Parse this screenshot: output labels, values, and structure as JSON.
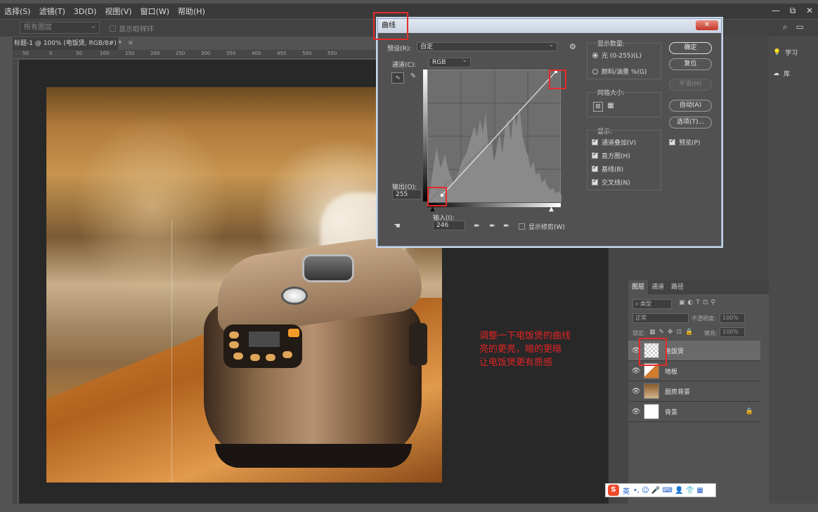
{
  "menu": {
    "items": [
      "选择(S)",
      "滤镜(T)",
      "3D(D)",
      "视图(V)",
      "窗口(W)",
      "帮助(H)"
    ],
    "window_controls": [
      "—",
      "⧉",
      "✕"
    ]
  },
  "options_bar": {
    "sample_select": "所有图层",
    "show_transform": "显示取样环"
  },
  "document": {
    "tab_title": "标题-1 @ 100% (电饭煲, RGB/8#) *",
    "tab_close": "✕",
    "ruler_marks": [
      "50",
      "0",
      "50",
      "100",
      "150",
      "200",
      "250",
      "300",
      "350",
      "400",
      "450",
      "500",
      "550"
    ]
  },
  "annotation": {
    "line1": "调整一下电饭煲的曲线",
    "line2": "亮的更亮，暗的更暗",
    "line3": "让电饭煲更有质感"
  },
  "curves_dialog": {
    "title": "曲线",
    "close": "✕",
    "preset_label": "预设(R):",
    "preset_value": "自定",
    "channel_label": "通道(C):",
    "channel_value": "RGB",
    "output_label": "输出(O):",
    "output_value": "255",
    "input_label": "输入(I):",
    "input_value": "246",
    "show_clipping": "显示修剪(W)",
    "display_amount_label": "显示数量:",
    "light_option": "光 (0-255)(L)",
    "pigment_option": "颜料/油墨 %(G)",
    "grid_size_label": "网格大小:",
    "show_label": "显示:",
    "show_options": [
      "通道叠加(V)",
      "直方图(H)",
      "基线(B)",
      "交叉线(N)"
    ],
    "preview": "预览(P)",
    "buttons": {
      "ok": "确定",
      "reset": "复位",
      "smooth": "平滑(M)",
      "auto": "自动(A)",
      "options": "选项(T)..."
    },
    "curve": {
      "input": [
        0,
        246
      ],
      "output": [
        0,
        255
      ]
    }
  },
  "right_panel": {
    "learn": "学习",
    "library": "库"
  },
  "layers_panel": {
    "tabs": [
      "图层",
      "通道",
      "路径"
    ],
    "filter_label": "类型",
    "blend_mode": "正常",
    "opacity_label": "不透明度:",
    "opacity_value": "100%",
    "lock_label": "锁定:",
    "fill_label": "填充:",
    "fill_value": "100%",
    "layers": [
      {
        "name": "电饭煲",
        "selected": true,
        "locked": false
      },
      {
        "name": "地板",
        "selected": false,
        "locked": false
      },
      {
        "name": "厨房背景",
        "selected": false,
        "locked": false
      },
      {
        "name": "背景",
        "selected": false,
        "locked": true
      }
    ]
  },
  "ime_bar": {
    "logo": "S",
    "mode": "英",
    "icons": "•, ☺ 🎤 ⌨ 👤 👕 ▦"
  }
}
